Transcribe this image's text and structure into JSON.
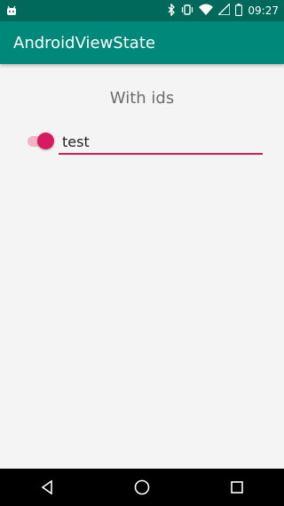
{
  "status_bar": {
    "time": "09:27",
    "icons": [
      "android-icon",
      "bluetooth-icon",
      "vibrate-icon",
      "wifi-icon",
      "signal-icon",
      "battery-icon"
    ]
  },
  "app_bar": {
    "title": "AndroidViewState"
  },
  "main": {
    "heading": "With ids",
    "switch": {
      "checked": true,
      "accent": "#d81b60"
    },
    "edit_text": {
      "value": "test"
    }
  },
  "nav_bar": {
    "buttons": [
      "back-icon",
      "home-icon",
      "recents-icon"
    ]
  },
  "colors": {
    "primary": "#00897b",
    "primary_dark": "#00695c",
    "accent": "#d81b60"
  }
}
